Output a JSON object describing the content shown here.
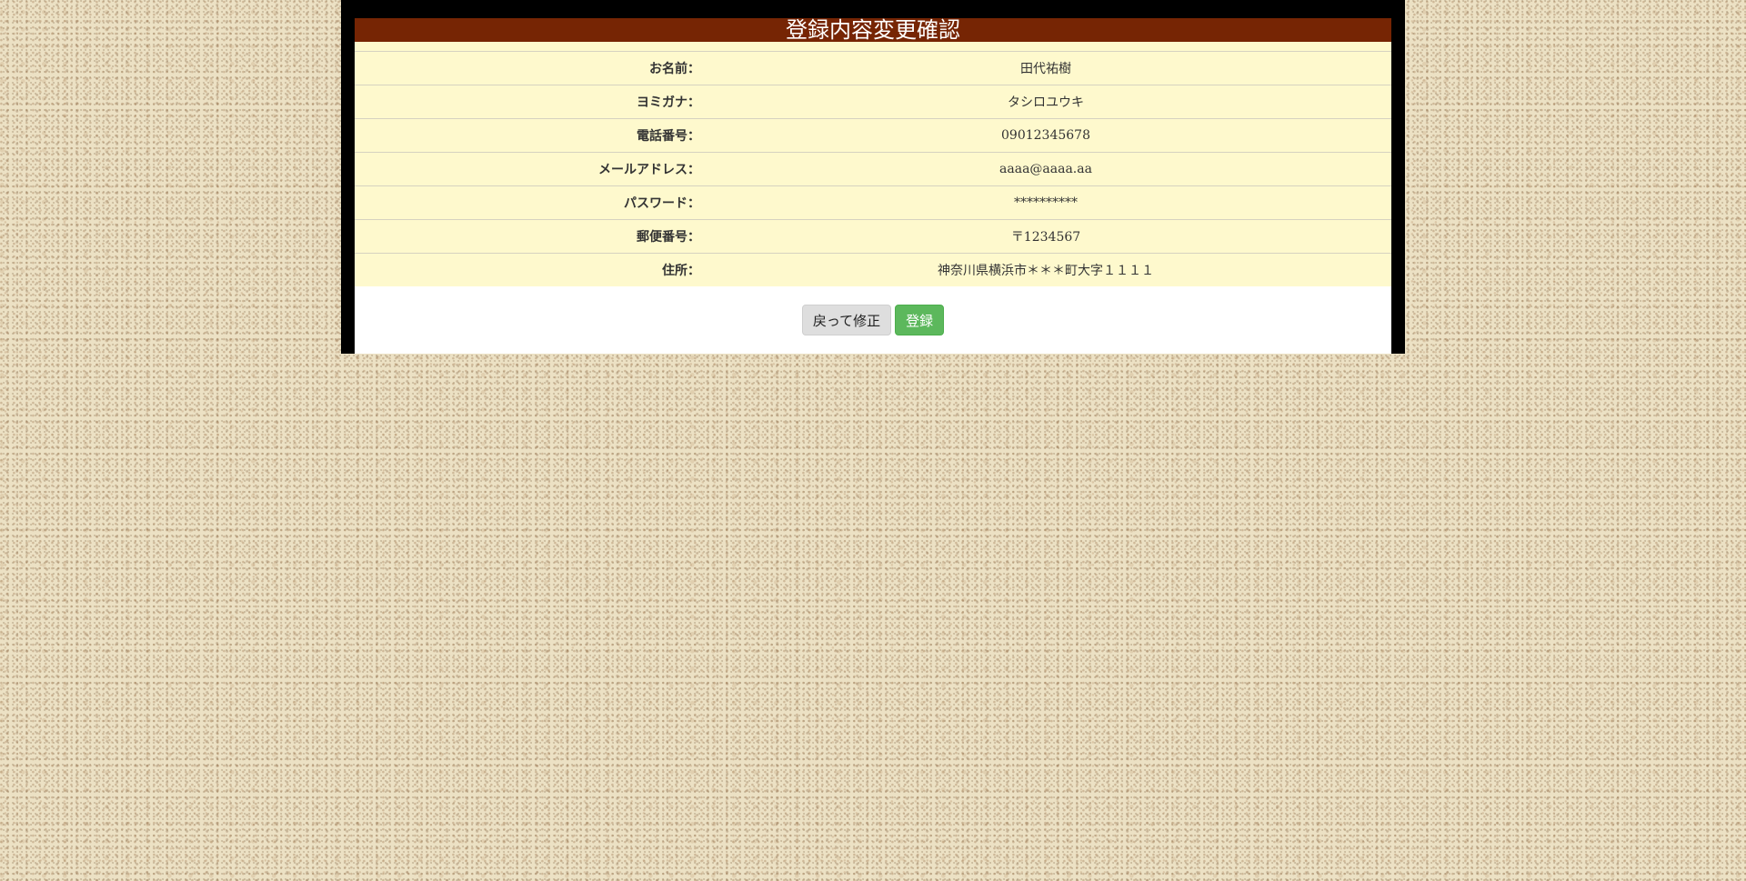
{
  "page": {
    "title": "登録内容変更確認"
  },
  "rows": [
    {
      "label": "お名前：",
      "value": "田代祐樹"
    },
    {
      "label": "ヨミガナ：",
      "value": "タシロユウキ"
    },
    {
      "label": "電話番号：",
      "value": "09012345678"
    },
    {
      "label": "メールアドレス：",
      "value": "aaaa@aaaa.aa"
    },
    {
      "label": "パスワード：",
      "value": "**********"
    },
    {
      "label": "郵便番号：",
      "value": "〒1234567"
    },
    {
      "label": "住所：",
      "value": "神奈川県横浜市＊＊＊町大字１１１１"
    }
  ],
  "buttons": {
    "back_label": "戻って修正",
    "submit_label": "登録"
  },
  "colors": {
    "title_bar": "#762504",
    "table_bg": "#fef9cd",
    "submit_button": "#5cb85c",
    "back_button": "#dedede"
  }
}
